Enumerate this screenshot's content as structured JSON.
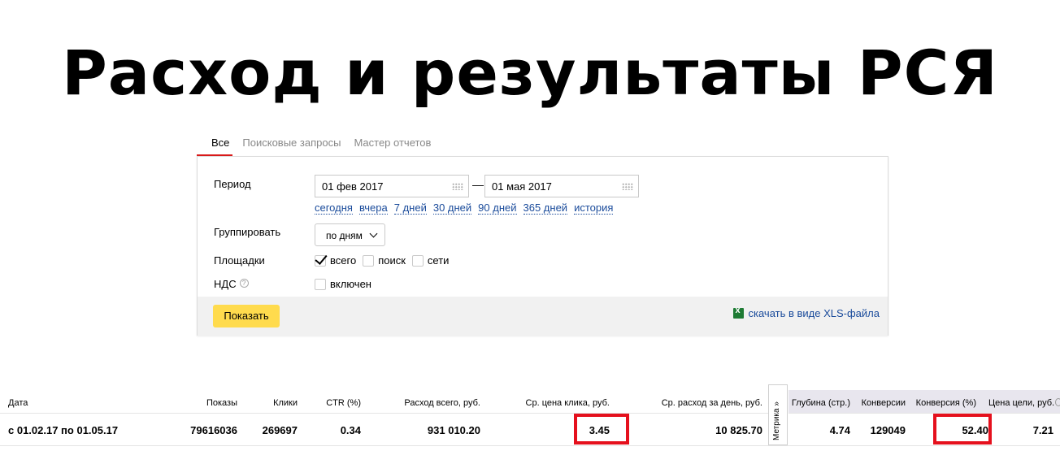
{
  "slide": {
    "title": "Расход и результаты РСЯ"
  },
  "tabs": [
    {
      "label": "Все",
      "active": true
    },
    {
      "label": "Поисковые запросы",
      "active": false
    },
    {
      "label": "Мастер отчетов",
      "active": false
    }
  ],
  "form": {
    "period_label": "Период",
    "date_from": "01 фев 2017",
    "date_to": "01 мая 2017",
    "dash": "—",
    "quick_links": [
      "сегодня",
      "вчера",
      "7 дней",
      "30 дней",
      "90 дней",
      "365 дней",
      "история"
    ],
    "group_label": "Группировать",
    "group_value": "по дням",
    "platforms_label": "Площадки",
    "platforms": [
      {
        "label": "всего",
        "checked": true
      },
      {
        "label": "поиск",
        "checked": false
      },
      {
        "label": "сети",
        "checked": false
      }
    ],
    "vat_label": "НДС",
    "vat_help": "?",
    "vat_option": {
      "label": "включен",
      "checked": false
    },
    "submit_label": "Показать",
    "xls_label": "скачать в виде XLS-файла"
  },
  "stats": {
    "headers": {
      "date": "Дата",
      "shows": "Показы",
      "clicks": "Клики",
      "ctr": "CTR (%)",
      "spend_total": "Расход всего, руб.",
      "avg_cpc": "Ср. цена клика, руб.",
      "avg_daily": "Ср. расход за день, руб.",
      "metrika_tab": "Метрика »",
      "depth": "Глубина (стр.)",
      "conversions": "Конверсии",
      "conv_rate": "Конверсия (%)",
      "goal_price": "Цена цели, руб."
    },
    "row": {
      "date": "с 01.02.17 по 01.05.17",
      "shows": "79616036",
      "clicks": "269697",
      "ctr": "0.34",
      "spend_total": "931 010.20",
      "avg_cpc": "3.45",
      "avg_daily": "10 825.70",
      "depth": "4.74",
      "conversions": "129049",
      "conv_rate": "52.40",
      "goal_price": "7.21"
    },
    "highlight_color": "#e5101d",
    "highlighted": [
      "avg_cpc",
      "conv_rate"
    ]
  },
  "colors": {
    "accent_yellow": "#ffdb4d",
    "link_blue": "#1a4b9b",
    "tab_active_underline": "#d91a1a",
    "metrika_header_bg": "#e8e6ee"
  }
}
